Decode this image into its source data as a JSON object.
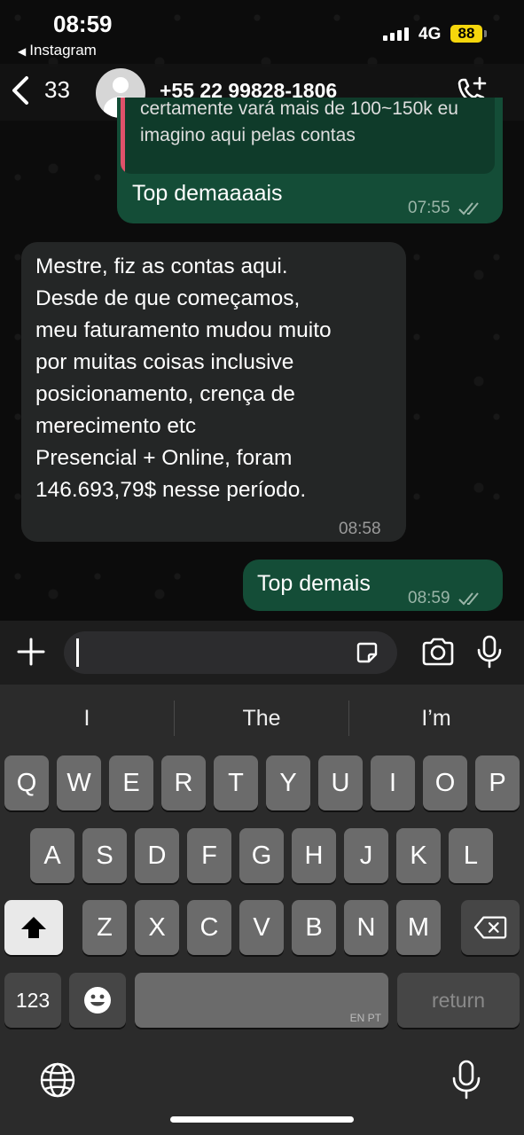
{
  "status_bar": {
    "time": "08:59",
    "back_app": "Instagram",
    "network": "4G",
    "battery": "88"
  },
  "header": {
    "unread_count": "33",
    "contact": "+55 22 99828-1806"
  },
  "messages": [
    {
      "direction": "outgoing",
      "quoted_text": "certamente vará mais de 100~150k eu imagino aqui pelas contas",
      "text": "Top demaaaais",
      "time": "07:55",
      "status": "read"
    },
    {
      "direction": "incoming",
      "lines": [
        "Mestre, fiz as contas aqui.",
        "Desde de que começamos,",
        "meu faturamento mudou muito",
        "por muitas coisas inclusive",
        "posicionamento, crença de",
        "merecimento etc",
        "Presencial + Online, foram",
        "146.693,79$ nesse período."
      ],
      "time": "08:58"
    },
    {
      "direction": "outgoing",
      "text": "Top demais",
      "time": "08:59",
      "status": "read"
    }
  ],
  "keyboard": {
    "suggestions": [
      "I",
      "The",
      "I’m"
    ],
    "row1": [
      "Q",
      "W",
      "E",
      "R",
      "T",
      "Y",
      "U",
      "I",
      "O",
      "P"
    ],
    "row2": [
      "A",
      "S",
      "D",
      "F",
      "G",
      "H",
      "J",
      "K",
      "L"
    ],
    "row3": [
      "Z",
      "X",
      "C",
      "V",
      "B",
      "N",
      "M"
    ],
    "numbers_key": "123",
    "return_key": "return",
    "space_lang": "EN PT"
  },
  "icons": {
    "back": "chevron-left-icon",
    "avatar": "person-icon",
    "call": "add-call-icon",
    "plus": "plus-icon",
    "sticker": "sticker-icon",
    "camera": "camera-icon",
    "mic": "microphone-icon",
    "shift": "shift-arrow-icon",
    "delete": "backspace-icon",
    "emoji": "emoji-icon",
    "globe": "globe-icon"
  },
  "colors": {
    "outgoing_bubble": "#144d37",
    "incoming_bubble": "#242626",
    "quote_bar": "#e0516a",
    "battery": "#f5d60c"
  }
}
